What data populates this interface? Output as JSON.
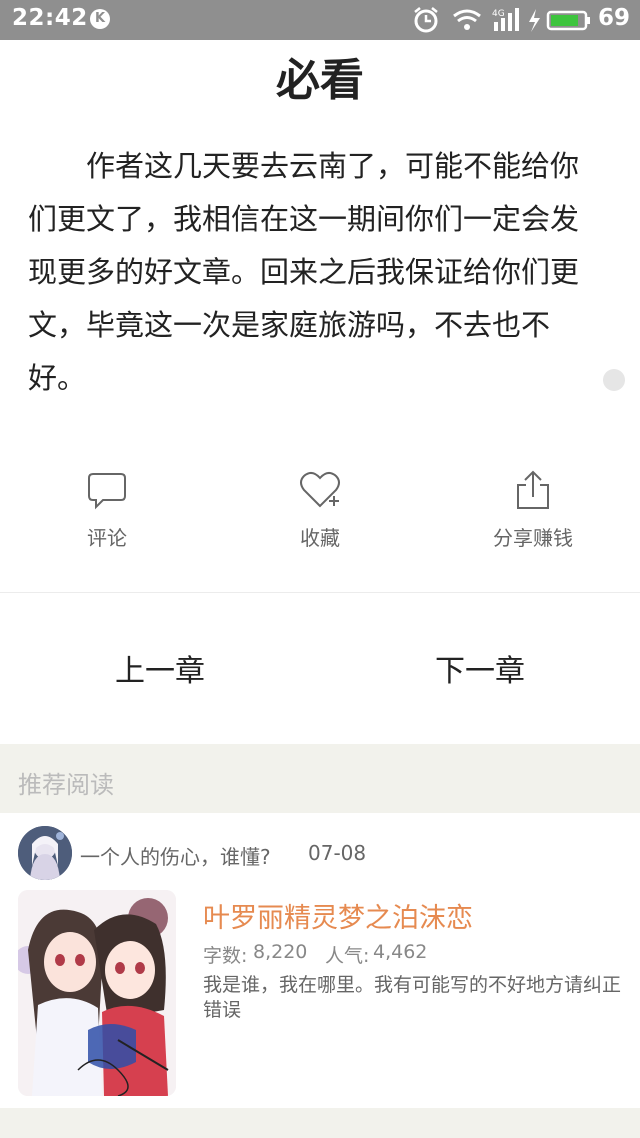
{
  "status_bar": {
    "time": "22:42",
    "k_badge": "K",
    "network": "4G",
    "battery_level": "69",
    "battery_color": "#3ec43e"
  },
  "article": {
    "title": "必看",
    "body": "作者这几天要去云南了，可能不能给你们更文了，我相信在这一期间你们一定会发现更多的好文章。回来之后我保证给你们更文，毕竟这一次是家庭旅游吗，不去也不好。"
  },
  "actions": {
    "comment_icon": "speech-bubble-icon",
    "comment_label": "评论",
    "favorite_icon": "heart-plus-icon",
    "favorite_label": "收藏",
    "share_icon": "share-icon",
    "share_label": "分享赚钱"
  },
  "chapter_nav": {
    "prev_label": "上一章",
    "next_label": "下一章"
  },
  "recommend": {
    "header": "推荐阅读",
    "items": [
      {
        "author": "一个人的伤心，谁懂?",
        "date": "07-08",
        "title": "叶罗丽精灵梦之泊沫恋",
        "wordcount_label": "字数:",
        "wordcount": "8,220",
        "popularity_label": "人气:",
        "popularity": "4,462",
        "description": "我是谁，我在哪里。我有可能写的不好地方请纠正错误",
        "title_color": "#e68a50"
      }
    ]
  }
}
